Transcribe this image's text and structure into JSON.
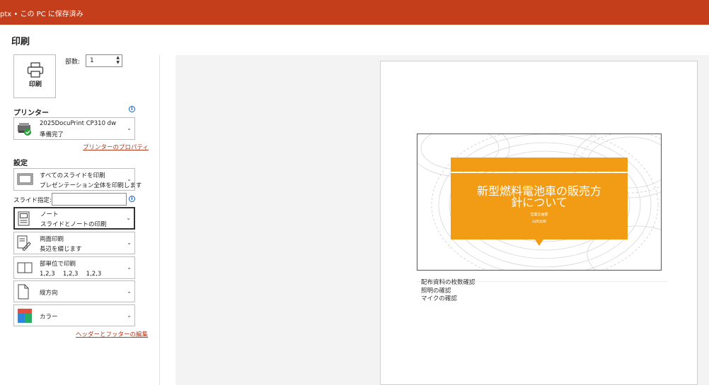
{
  "titlebar": {
    "text": "ptx • この PC に保存済み"
  },
  "page": {
    "title": "印刷"
  },
  "print_button": {
    "label": "印刷"
  },
  "copies": {
    "label": "部数:",
    "value": "1"
  },
  "printer": {
    "section": "プリンター",
    "name": "2025DocuPrint CP310 dw",
    "status": "準備完了",
    "properties_link": "プリンターのプロパティ"
  },
  "settings": {
    "section": "設定",
    "slides_label": "スライド指定:",
    "slides_value": "",
    "options": [
      {
        "line1": "すべてのスライドを印刷",
        "line2": "プレゼンテーション全体を印刷します",
        "icon": "slides-icon"
      },
      {
        "line1": "ノート",
        "line2": "スライドとノートの印刷",
        "icon": "notes-page-icon"
      },
      {
        "line1": "両面印刷",
        "line2": "長辺を綴じます",
        "icon": "duplex-icon"
      },
      {
        "line1": "部単位で印刷",
        "line2": "1,2,3　 1,2,3　 1,2,3",
        "icon": "collate-icon"
      },
      {
        "line1": "縦方向",
        "line2": "",
        "icon": "portrait-icon"
      },
      {
        "line1": "カラー",
        "line2": "",
        "icon": "color-icon"
      }
    ],
    "header_footer_link": "ヘッダーとフッターの編集"
  },
  "preview": {
    "slide_title": "新型燃料電池車の販売方針について",
    "slide_dept": "営業企画部",
    "slide_name": "山田太郎",
    "notes": [
      "配布資料の枚数確認",
      "照明の確認",
      "マイクの確認"
    ]
  },
  "colors": {
    "accent": "#c43e1c",
    "slide_orange": "#f29b14",
    "link": "#b5381b"
  }
}
